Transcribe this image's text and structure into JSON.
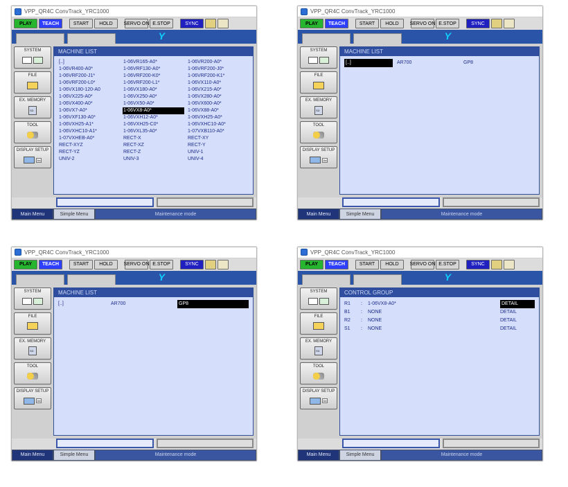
{
  "window_title": "VPP_QR4C ConvTrack_YRC1000",
  "brand_letter": "Y",
  "toprow": {
    "play": "PLAY",
    "teach": "TEACH",
    "start": "START",
    "hold": "HOLD",
    "servo": "SERVO ON",
    "estop": "E.STOP",
    "sync": "SYNC"
  },
  "sidebar": {
    "system": "SYSTEM",
    "file": "FILE",
    "exmem": "EX. MEMORY",
    "tool": "TOOL",
    "display": "DISPLAY SETUP"
  },
  "statusbar": {
    "main": "Main Menu",
    "simple": "Simple Menu",
    "maint": "Maintenance mode"
  },
  "panel1": {
    "header": "MACHINE LIST",
    "items": [
      "[..]",
      "1-06VR165-A0*",
      "1-06VR200-A0*",
      "1-06VR400-A0*",
      "1-06VRF130-A0*",
      "1-06VRF200-J0*",
      "1-06VRF200-J1*",
      "1-06VRF200-K0*",
      "1-06VRF200-K1*",
      "1-06VRF200-L0*",
      "1-06VRF200-L1*",
      "1-06VX110-A0*",
      "1-06VX180-120-A0",
      "1-06VX180-A0*",
      "1-06VX215-A0*",
      "1-06VX225-A0*",
      "1-06VX250-A0*",
      "1-06VX280-A0*",
      "1-06VX400-A0*",
      "1-06VX50-A0*",
      "1-06VX600-A0*",
      "1-06VX7-A0*",
      "1-06VX8-A0*",
      "1-06VX88-A0*",
      "1-06VXF130-A0*",
      "1-06VXH12-A0*",
      "1-06VXH25-A0*",
      "1-06VXH25-A1*",
      "1-06VXH25-C0*",
      "1-06VXHC10-A0*",
      "1-06VXHC10-A1*",
      "1-06VXL35-A0*",
      "1-07VXB110-A0*",
      "1-07VXHEB-A0*",
      "RECT-X",
      "RECT-XY",
      "RECT-XYZ",
      "RECT-XZ",
      "RECT-Y",
      "RECT-YZ",
      "RECT-Z",
      "UNIV-1",
      "UNIV-2",
      "UNIV-3",
      "UNIV-4"
    ],
    "selected": "1-06VX8-A0*"
  },
  "panel2": {
    "header": "MACHINE LIST",
    "row": {
      "c1": "[..]",
      "c2": "AR700",
      "c3": "GP8"
    },
    "selected": "[..]"
  },
  "panel3": {
    "header": "MACHINE LIST",
    "row": {
      "c1": "[..]",
      "c2": "AR700",
      "c3": "GP8"
    },
    "selected": "GP8"
  },
  "panel4": {
    "header": "CONTROL GROUP",
    "rows": [
      {
        "g": "R1",
        "v": "1-06VX8-A0*",
        "d": "DETAIL",
        "sel": true
      },
      {
        "g": "B1",
        "v": "NONE",
        "d": "DETAIL"
      },
      {
        "g": "R2",
        "v": "NONE",
        "d": "DETAIL"
      },
      {
        "g": "S1",
        "v": "NONE",
        "d": "DETAIL"
      }
    ]
  }
}
